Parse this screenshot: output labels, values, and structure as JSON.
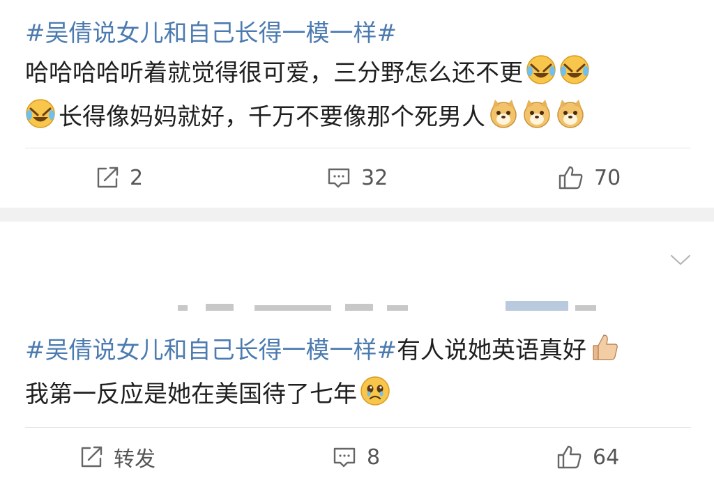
{
  "posts": [
    {
      "hashtag": "#吴倩说女儿和自己长得一模一样#",
      "line1": "哈哈哈哈听着就觉得很可爱，三分野怎么还不更",
      "line2": "长得像妈妈就好，千万不要像那个死男人",
      "emojis": [
        "laugh-cry-emoji",
        "laugh-cry-emoji",
        "laugh-cry-emoji",
        "doge-emoji",
        "doge-emoji",
        "doge-emoji"
      ],
      "actions": {
        "repost": "2",
        "comments": "32",
        "likes": "70"
      }
    },
    {
      "hashtag": "#吴倩说女儿和自己长得一模一样#",
      "line1_rest": "有人说她英语真好",
      "line2": "我第一反应是她在美国待了七年",
      "emojis": [
        "thumbs-up-emoji",
        "teary-emoji"
      ],
      "actions": {
        "repost": "转发",
        "comments": "8",
        "likes": "64"
      }
    }
  ],
  "colors": {
    "hashtag": "#4c7bb0",
    "text": "#1f1f1f",
    "separator": "#f1f1f1",
    "icon": "#555555"
  }
}
